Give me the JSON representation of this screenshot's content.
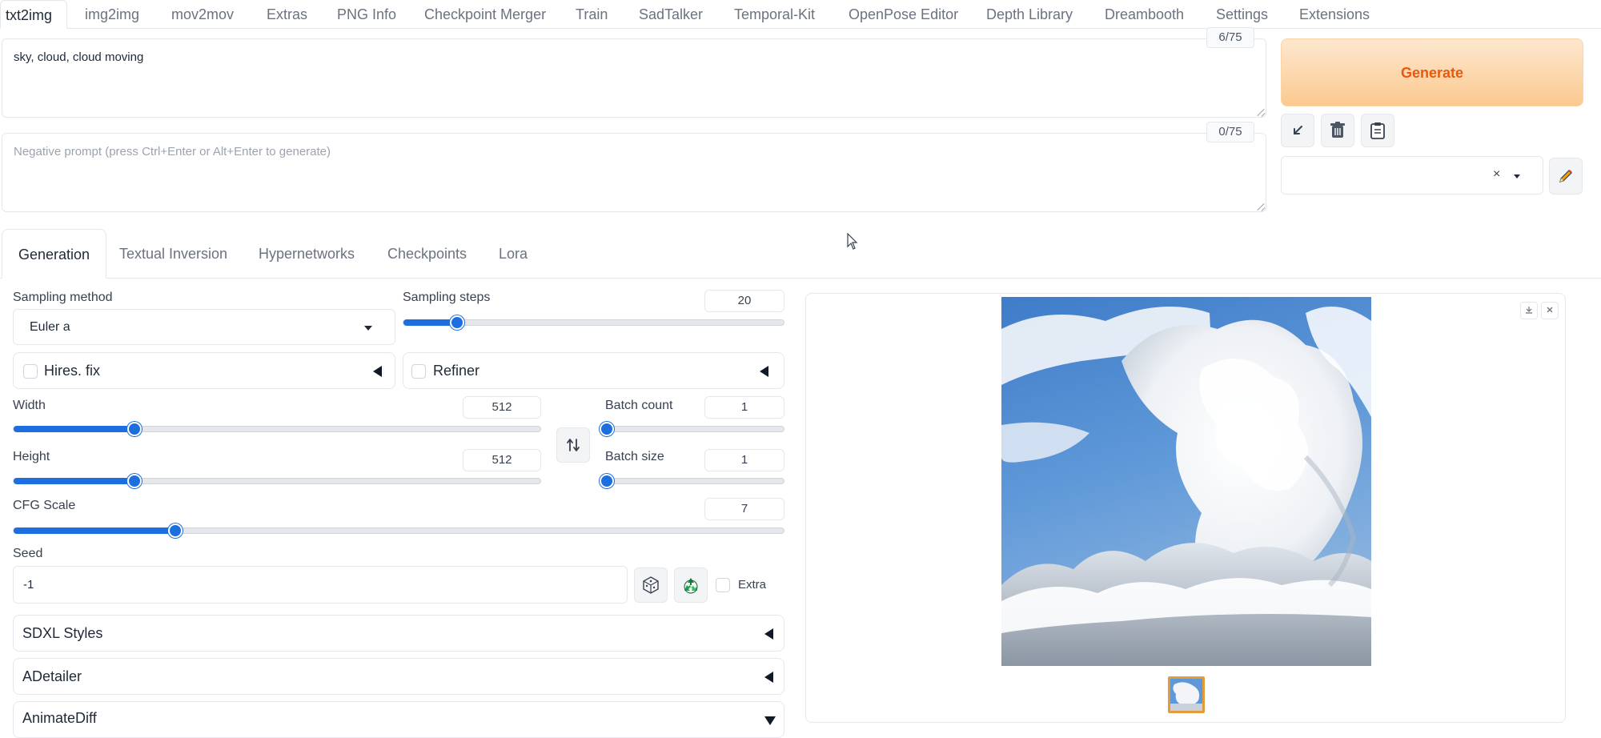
{
  "top_tabs": [
    {
      "label": "txt2img"
    },
    {
      "label": "img2img"
    },
    {
      "label": "mov2mov"
    },
    {
      "label": "Extras"
    },
    {
      "label": "PNG Info"
    },
    {
      "label": "Checkpoint Merger"
    },
    {
      "label": "Train"
    },
    {
      "label": "SadTalker"
    },
    {
      "label": "Temporal-Kit"
    },
    {
      "label": "OpenPose Editor"
    },
    {
      "label": "Depth Library"
    },
    {
      "label": "Dreambooth"
    },
    {
      "label": "Settings"
    },
    {
      "label": "Extensions"
    }
  ],
  "prompt": {
    "value": "sky, cloud, cloud moving",
    "token_count": "6/75"
  },
  "negative_prompt": {
    "placeholder": "Negative prompt (press Ctrl+Enter or Alt+Enter to generate)",
    "token_count": "0/75"
  },
  "generate_label": "Generate",
  "tool_icons": [
    "arrow-down-left-icon",
    "trash-icon",
    "clipboard-icon"
  ],
  "style_clear": "×",
  "sub_tabs": [
    {
      "label": "Generation"
    },
    {
      "label": "Textual Inversion"
    },
    {
      "label": "Hypernetworks"
    },
    {
      "label": "Checkpoints"
    },
    {
      "label": "Lora"
    }
  ],
  "sampling": {
    "method_label": "Sampling method",
    "method_value": "Euler a",
    "steps_label": "Sampling steps",
    "steps_value": "20",
    "steps_fraction": 0.14
  },
  "hires_fix_label": "Hires. fix",
  "refiner_label": "Refiner",
  "width": {
    "label": "Width",
    "value": "512",
    "fraction": 0.23
  },
  "height": {
    "label": "Height",
    "value": "512",
    "fraction": 0.23
  },
  "batch_count": {
    "label": "Batch count",
    "value": "1",
    "fraction": 0.0
  },
  "batch_size": {
    "label": "Batch size",
    "value": "1",
    "fraction": 0.0
  },
  "cfg_scale": {
    "label": "CFG Scale",
    "value": "7",
    "fraction": 0.21
  },
  "seed": {
    "label": "Seed",
    "value": "-1",
    "extra_label": "Extra"
  },
  "accordions": [
    {
      "label": "SDXL Styles"
    },
    {
      "label": "ADetailer"
    },
    {
      "label": "AnimateDiff"
    }
  ],
  "colors": {
    "accent": "#1d6fe0",
    "generate_text": "#ea580c",
    "generate_bg": "#fbc98f"
  }
}
